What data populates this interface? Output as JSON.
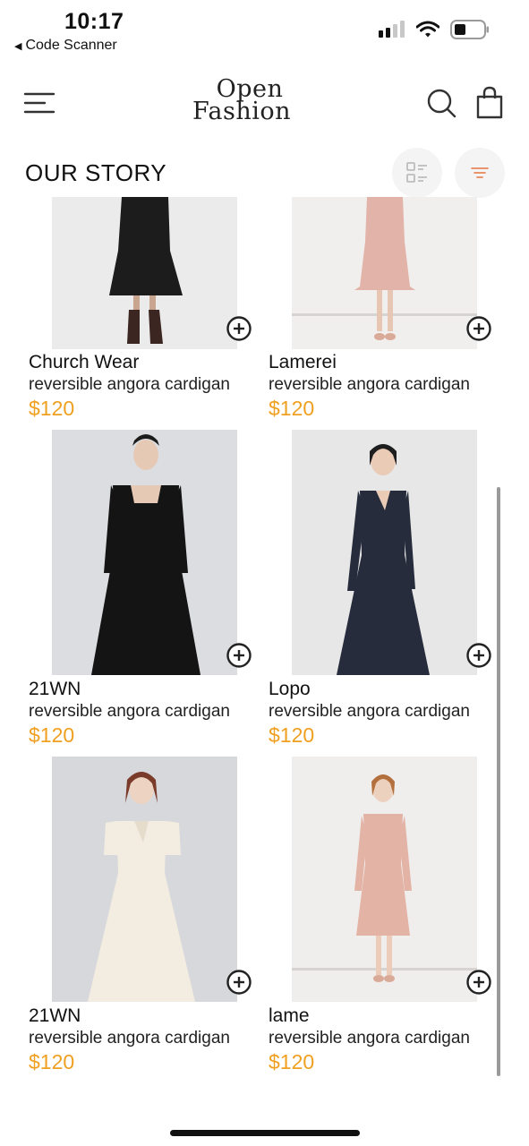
{
  "status": {
    "time": "10:17",
    "back_label": "Code Scanner"
  },
  "header": {
    "logo_line1": "Open",
    "logo_line2": "Fashion"
  },
  "page_title": "OUR STORY",
  "products": [
    {
      "name": "Church Wear",
      "desc": "reversible angora cardigan",
      "price": "$120"
    },
    {
      "name": "Lamerei",
      "desc": "reversible angora cardigan",
      "price": "$120"
    },
    {
      "name": "21WN",
      "desc": "reversible angora cardigan",
      "price": "$120"
    },
    {
      "name": "Lopo",
      "desc": "reversible angora cardigan",
      "price": "$120"
    },
    {
      "name": "21WN",
      "desc": "reversible angora cardigan",
      "price": "$120"
    },
    {
      "name": "lame",
      "desc": "reversible angora cardigan",
      "price": "$120"
    }
  ],
  "colors": {
    "price": "#f0a020",
    "filter_accent": "#e8875a"
  },
  "icons": [
    "menu-icon",
    "search-icon",
    "shopping-bag-icon",
    "list-view-icon",
    "filter-icon",
    "add-circle-icon"
  ]
}
